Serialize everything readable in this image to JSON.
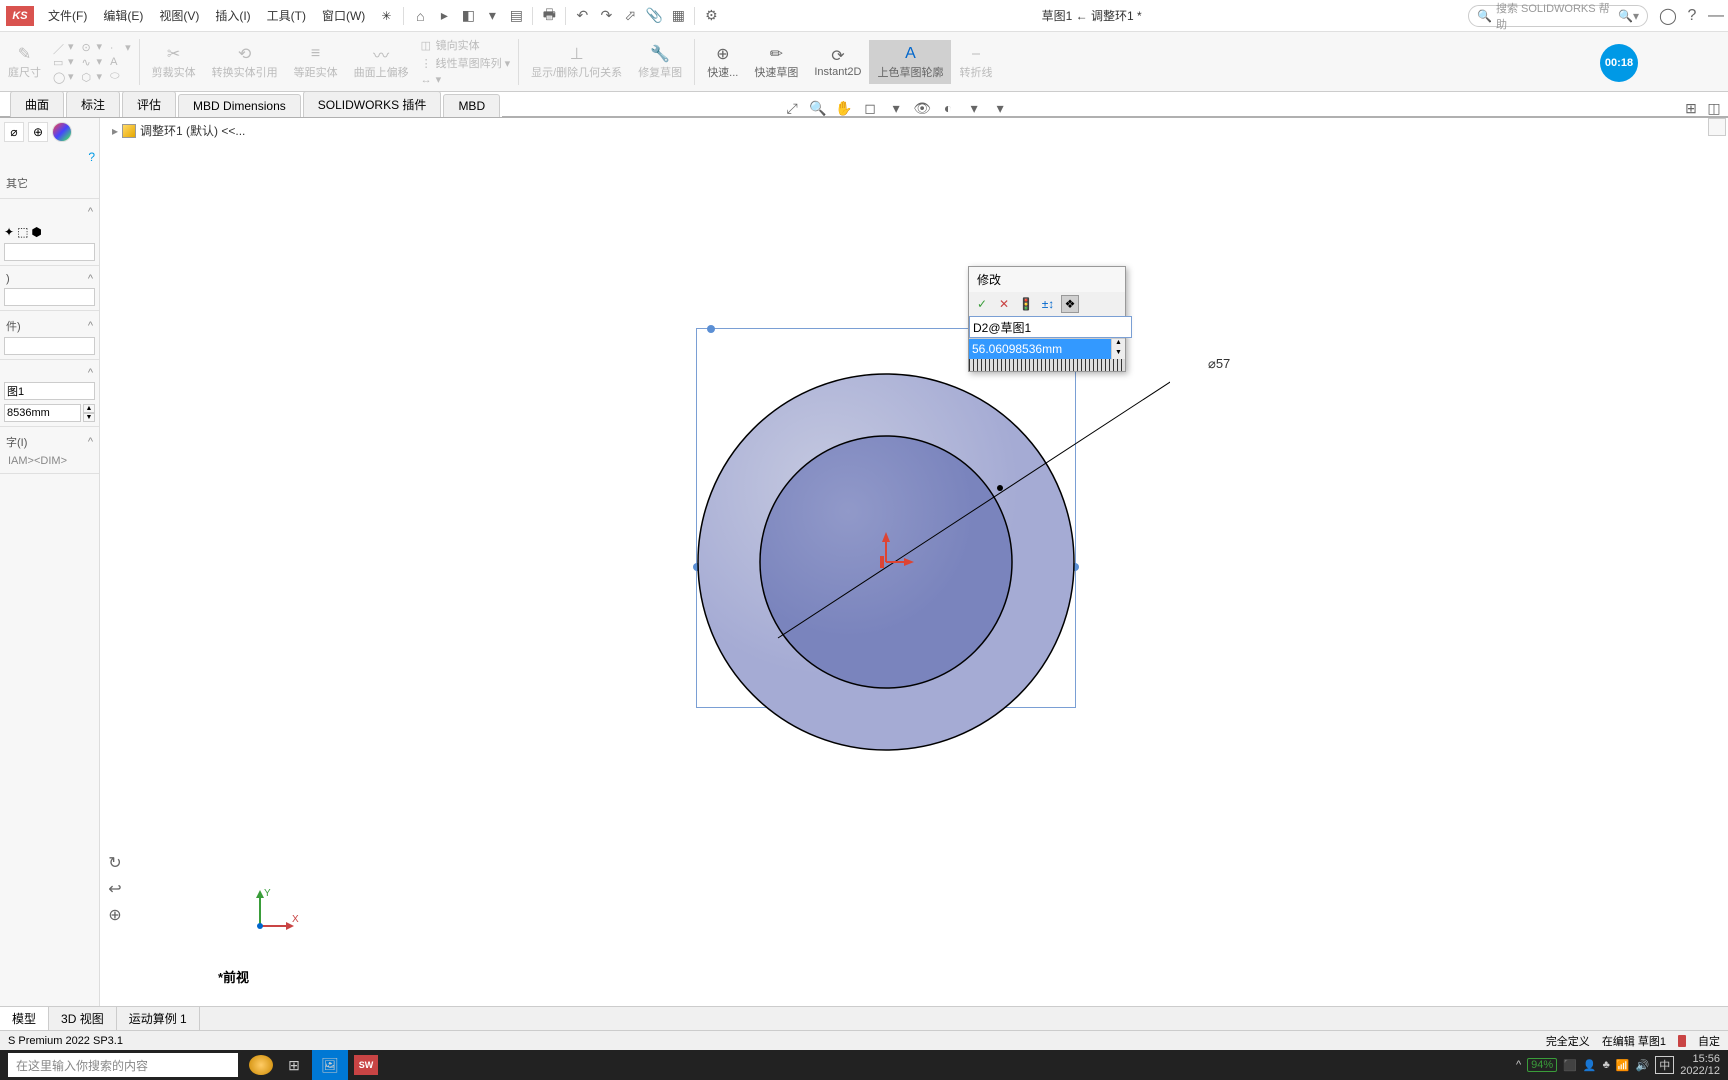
{
  "menus": {
    "file": "文件(F)",
    "edit": "编辑(E)",
    "view": "视图(V)",
    "insert": "插入(I)",
    "tools": "工具(T)",
    "window": "窗口(W)"
  },
  "doc_title": "草图1 ← 调整环1 *",
  "search_placeholder": "搜索 SOLIDWORKS 帮助",
  "ribbon": {
    "measure": "庭尺寸",
    "trim": "剪裁实体",
    "convert": "转换实体引用",
    "offset": "等距实体",
    "curve": "曲面上偏移",
    "mirror": "镜向实体",
    "linear": "线性草图阵列",
    "show": "显示/删除几何关系",
    "repair": "修复草图",
    "quick": "快速...",
    "quick_sketch": "快速草图",
    "instant": "Instant2D",
    "shade": "上色草图轮廓",
    "fold": "转折线"
  },
  "tabs": [
    "曲面",
    "标注",
    "评估",
    "MBD Dimensions",
    "SOLIDWORKS 插件",
    "MBD"
  ],
  "breadcrumb": "调整环1 (默认) <<...",
  "side": {
    "other": "其它",
    "sketch": "图1",
    "dim_val": "8536mm",
    "font": "字(I)",
    "diam": "IAM><DIM>"
  },
  "dialog": {
    "title": "修改",
    "name": "D2@草图1",
    "value": "56.06098536mm"
  },
  "dim_label": "⌀57",
  "view_name": "*前视",
  "timer": "00:18",
  "bottom_tabs": [
    "模型",
    "3D 视图",
    "运动算例 1"
  ],
  "status": {
    "product": "S Premium 2022 SP3.1",
    "defined": "完全定义",
    "editing": "在编辑 草图1",
    "auto": "自定"
  },
  "taskbar": {
    "search": "在这里输入你搜索的内容",
    "sw": "SW",
    "battery": "94%",
    "ime": "中",
    "time": "15:56",
    "date": "2022/12"
  }
}
